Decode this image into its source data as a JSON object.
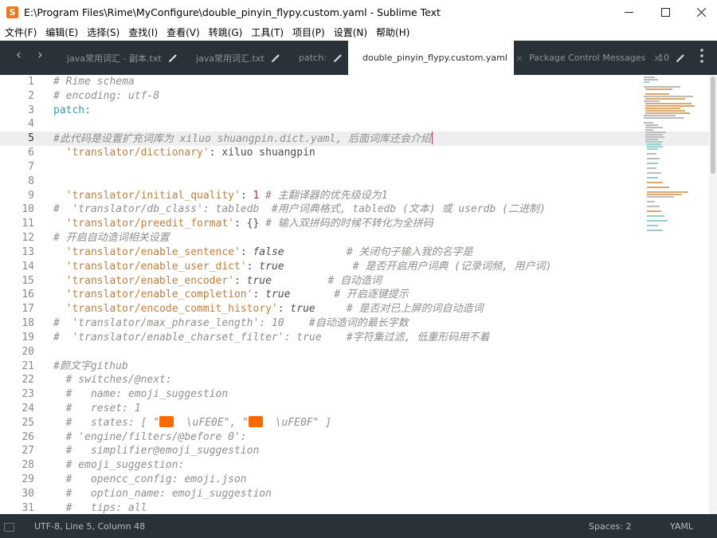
{
  "window": {
    "title": "E:\\Program Files\\Rime\\MyConfigure\\double_pinyin_flypy.custom.yaml - Sublime Text",
    "app_icon": "sublime-text-icon",
    "app_icon_glyph": "S"
  },
  "menu": [
    "文件(F)",
    "编辑(E)",
    "选择(S)",
    "查找(I)",
    "查看(V)",
    "转跳(G)",
    "工具(T)",
    "项目(P)",
    "设置(N)",
    "帮助(H)"
  ],
  "tabs": [
    {
      "label": "java常用词汇 - 副本.txt",
      "dirty": true
    },
    {
      "label": "java常用词汇.txt",
      "dirty": true
    },
    {
      "label": "patch:",
      "dirty": true
    },
    {
      "label": "double_pinyin_flypy.custom.yaml",
      "active": true,
      "close": "×"
    },
    {
      "label": "Package Control Messages",
      "close": "×"
    },
    {
      "label": "10",
      "dirty": true
    }
  ],
  "editor": {
    "current_line": 5,
    "line_numbers": [
      "1",
      "2",
      "3",
      "4",
      "5",
      "6",
      "7",
      "8",
      "9",
      "10",
      "11",
      "12",
      "13",
      "14",
      "15",
      "16",
      "17",
      "18",
      "19",
      "20",
      "21",
      "22",
      "23",
      "24",
      "25",
      "26",
      "27",
      "28",
      "29",
      "30",
      "31"
    ],
    "lines": {
      "l1": "# Rime schema",
      "l2": "# encoding: utf-8",
      "l3": "patch:",
      "l5": "#此代码是设置扩充词库为 xiluo shuangpin.dict.yaml, 后面词库还会介绍",
      "l6_key": "'translator/dictionary'",
      "l6_val": ": xiluo shuangpin",
      "l9_key": "'translator/initial_quality'",
      "l9_colon": ": ",
      "l9_num": "1",
      "l9_comment": " # 主翻译器的优先级设为1",
      "l10": "#  'translator/db_class': tabledb  #用户词典格式, tabledb (文本) 或 userdb (二进制)",
      "l11_key": "'translator/preedit_format'",
      "l11_val": ": {}",
      "l11_comment": " # 输入双拼码的时候不转化为全拼码",
      "l12": "# 开启自动造词相关设置",
      "l13_key": "'translator/enable_sentence'",
      "l13_colon": ": ",
      "l13_val": "false",
      "l13_comment": "          # 关闭句子输入我的名字是",
      "l14_key": "'translator/enable_user_dict'",
      "l14_colon": ": ",
      "l14_val": "true",
      "l14_comment": "           # 是否开启用户词典 (记录词频, 用户词)",
      "l15_key": "'translator/enable_encoder'",
      "l15_colon": ": ",
      "l15_val": "true",
      "l15_comment": "         # 自动造词",
      "l16_key": "'translator/enable_completion'",
      "l16_colon": ": ",
      "l16_val": "true",
      "l16_comment": "       # 开启逐键提示",
      "l17_key": "'translator/encode_commit_history'",
      "l17_colon": ": ",
      "l17_val": "true",
      "l17_comment": "     # 是否对已上屏的词自动造词",
      "l18": "#  'translator/max_phrase_length': 10    #自动造词的最长字数",
      "l19": "#  'translator/enable_charset_filter': true    #字符集过滤, 低重形码用不着",
      "l21": "#颜文字github",
      "l22": "  # switches/@next:",
      "l23": "  #   name: emoji_suggestion",
      "l24": "  #   reset: 1",
      "l25a": "  #   states: [ \"",
      "l25b": "  \\uFE0E\", \"",
      "l25c": "  \\uFE0F\" ]",
      "l26": "  # 'engine/filters/@before 0':",
      "l27": "  #   simplifier@emoji_suggestion",
      "l28": "  # emoji_suggestion:",
      "l29": "  #   opencc_config: emoji.json",
      "l30": "  #   option_name: emoji_suggestion",
      "l31": "  #   tips: all"
    }
  },
  "status": {
    "position": "UTF-8, Line 5, Column 48",
    "spaces": "Spaces: 2",
    "syntax": "YAML"
  },
  "colors": {
    "tabbar_bg": "#2a3239",
    "statusbar_bg": "#2a3239",
    "comment": "#8e908c",
    "key_string": "#c07f3e",
    "number": "#c82829",
    "emoji_badge": "#ff6a00",
    "current_line": "#eeeeee"
  }
}
